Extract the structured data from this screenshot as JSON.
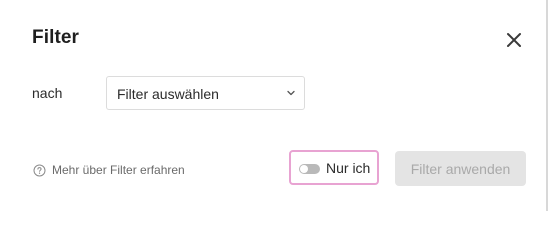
{
  "dialog": {
    "title": "Filter",
    "close_icon": "close-icon"
  },
  "filter_field": {
    "label": "nach",
    "selected_value": "Filter auswählen",
    "chevron_icon": "chevron-down-icon"
  },
  "footer": {
    "learn_more_icon": "help-circle-icon",
    "learn_more_text": "Mehr über Filter erfahren",
    "only_me_label": "Nur ich",
    "only_me_enabled": false,
    "apply_label": "Filter anwenden",
    "apply_enabled": false
  },
  "colors": {
    "toggle_focus_border": "#e8a3d2",
    "apply_disabled_bg": "#e4e4e4",
    "apply_disabled_text": "#a9a9a9"
  }
}
